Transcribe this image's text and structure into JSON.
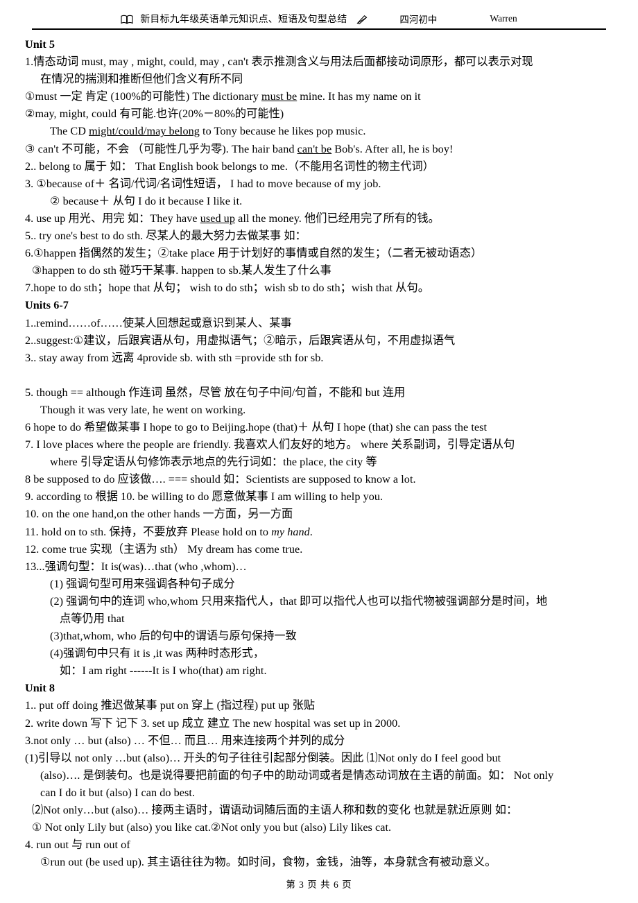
{
  "header": {
    "book_icon": "open-book-icon",
    "title": "新目标九年级英语单元知识点、短语及句型总结",
    "pen_icon": "pen-icon",
    "school": "四河初中",
    "author": "Warren"
  },
  "footer": {
    "page_label": "第 3 页 共 6 页"
  },
  "sections": [
    {
      "heading": "Unit 5",
      "lines": [
        "1.情态动词 must, may , might, could, may , can't 表示推测含义与用法后面都接动词原形，都可以表示对现",
        "在情况的揣测和推断但他们含义有所不同",
        "①must 一定 肯定 (100%的可能性) The dictionary must be mine. It has my name on it",
        "②may, might, could 有可能.也许(20%－80%的可能性)",
        "The CD might/could/may belong to Tony because he likes pop music.",
        "③ can't 不可能，不会 （可能性几乎为零). The hair band can't be Bob's. After all, he is boy!",
        "2.. belong to 属于 如： That English book belongs to me.（不能用名词性的物主代词）",
        "3. ①because of＋ 名词/代词/名词性短语， I had to move because of my job.",
        "② because＋ 从句 I do it because I like it.",
        "4. use up 用光、用完 如：They have used up all the money. 他们已经用完了所有的钱。",
        "5.. try one's best to do sth. 尽某人的最大努力去做某事 如：",
        "6.①happen 指偶然的发生；②take place 用于计划好的事情或自然的发生；（二者无被动语态）",
        "③happen to do sth 碰巧干某事. happen to sb.某人发生了什么事",
        "7.hope to do sth；hope that 从句； wish to do sth；wish sb to do sth；wish that 从句。"
      ]
    },
    {
      "heading": "Units 6-7",
      "lines": [
        "1..remind……of……使某人回想起或意识到某人、某事",
        "2..suggest:①建议，后跟宾语从句，用虚拟语气；②暗示，后跟宾语从句，不用虚拟语气",
        "3.. stay away from 远离 4provide sb. with sth =provide sth for sb.",
        "5. though == although 作连词 虽然，尽管 放在句子中间/句首，不能和 but 连用",
        "Though it was very late, he went on working.",
        "6 hope to do 希望做某事 I hope to go to Beijing.hope (that)＋ 从句 I hope (that) she can pass the test",
        "7. I love places where the people are friendly. 我喜欢人们友好的地方。 where 关系副词，引导定语从句",
        "where 引导定语从句修饰表示地点的先行词如：the place, the city 等",
        "8 be supposed to do 应该做…. === should 如：Scientists are supposed to know a lot.",
        "9. according to 根据 10. be willing to do 愿意做某事 I am willing to help you.",
        "10. on the one hand,on the other hands 一方面，另一方面",
        "11. hold on to sth. 保持，不要放弃 Please hold on to my hand.",
        "12. come true 实现（主语为 sth） My dream has come true.",
        "13...强调句型：It is(was)…that (who ,whom)…",
        "(1) 强调句型可用来强调各种句子成分",
        "(2) 强调句中的连词 who,whom 只用来指代人，that 即可以指代人也可以指代物被强调部分是时间，地",
        "点等仍用 that",
        "(3)that,whom, who 后的句中的谓语与原句保持一致",
        "(4)强调句中只有 it is ,it was 两种时态形式，",
        "如：I am right ------It is I who(that) am right."
      ]
    },
    {
      "heading": "Unit 8",
      "lines": [
        "1.. put off doing 推迟做某事 put on 穿上 (指过程) put up 张贴",
        "2. write down 写下 记下 3. set up 成立 建立 The new hospital was set up in 2000.",
        "3.not only … but (also) … 不但… 而且… 用来连接两个并列的成分",
        "(1)引导以 not only …but (also)… 开头的句子往往引起部分倒装。因此 ⑴Not only do I feel good but",
        "(also)…. 是倒装句。也是说得要把前面的句子中的助动词或者是情态动词放在主语的前面。如： Not only",
        "can I do it but (also) I can do best.",
        "⑵Not only…but (also)… 接两主语时，谓语动词随后面的主语人称和数的变化 也就是就近原则 如：",
        "① Not only Lily but (also) you like cat.②Not only you but (also) Lily likes cat.",
        "4. run out 与 run out of",
        "①run out (be used up). 其主语往往为物。如时间，食物，金钱，油等，本身就含有被动意义。"
      ]
    }
  ],
  "emphasis": {
    "must_be": "must be",
    "might_could_may_belong": "might/could/may belong",
    "cant_be": "can't be",
    "used_up": "used up",
    "my_hand": "my hand"
  }
}
